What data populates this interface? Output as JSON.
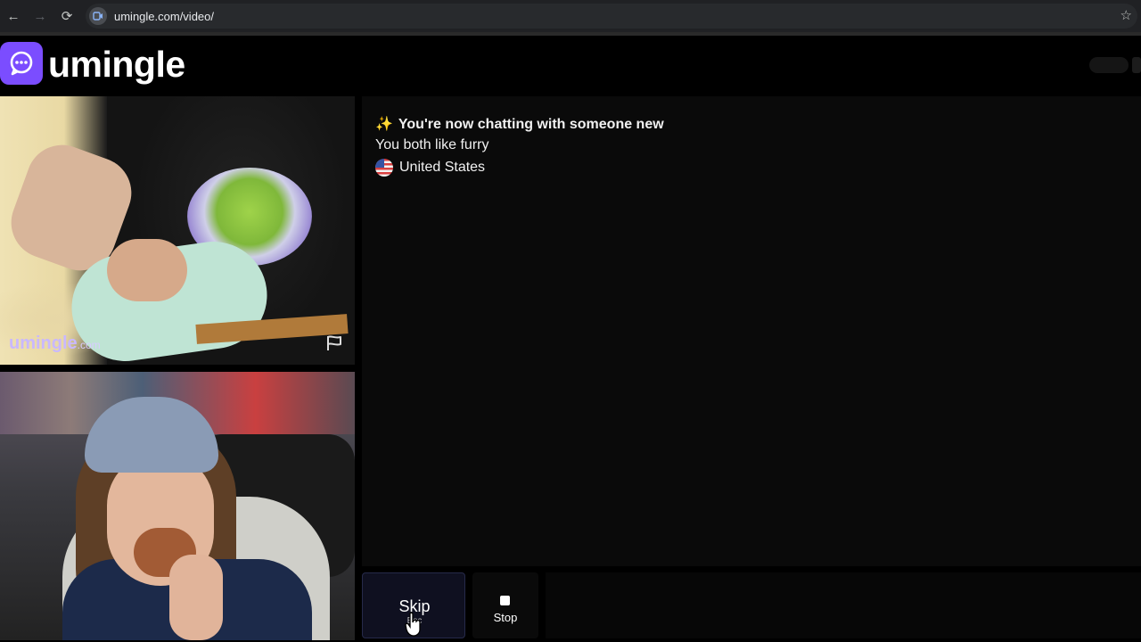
{
  "browser": {
    "url": "umingle.com/video/",
    "back_icon": "arrow-left-icon",
    "forward_icon": "arrow-right-icon",
    "reload_icon": "reload-icon",
    "bookmark_icon": "star-icon"
  },
  "header": {
    "logo_text": "umingle",
    "logo_icon": "chat-bubble-icon",
    "brand_color": "#7b4dff"
  },
  "remote_video": {
    "watermark": "umingle",
    "watermark_suffix": ".com",
    "report_icon": "flag-icon"
  },
  "chat": {
    "sparkle_icon": "✨",
    "connected_message": "You're now chatting with someone new",
    "interest_message": "You both like furry",
    "country": "United States",
    "country_flag_icon": "us-flag-icon"
  },
  "controls": {
    "skip_label": "Skip",
    "skip_hint": "Esc",
    "stop_label": "Stop",
    "stop_icon": "stop-icon"
  }
}
